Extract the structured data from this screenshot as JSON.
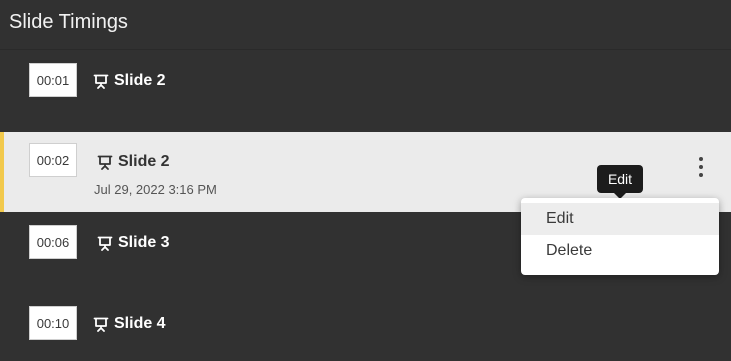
{
  "header": {
    "title": "Slide Timings"
  },
  "rows": [
    {
      "time": "00:01",
      "name": "Slide 2",
      "date": ""
    },
    {
      "time": "00:02",
      "name": "Slide 2",
      "date": "Jul 29, 2022 3:16 PM"
    },
    {
      "time": "00:06",
      "name": "Slide 3",
      "date": ""
    },
    {
      "time": "00:10",
      "name": "Slide 4",
      "date": ""
    }
  ],
  "tooltip": {
    "label": "Edit"
  },
  "menu": {
    "items": [
      {
        "label": "Edit"
      },
      {
        "label": "Delete"
      }
    ]
  },
  "icons": {
    "slide": "presentation-icon",
    "more": "more-vertical-icon"
  },
  "colors": {
    "accent": "#f2c94c",
    "background": "#313131",
    "selected_row": "#ebebeb"
  }
}
